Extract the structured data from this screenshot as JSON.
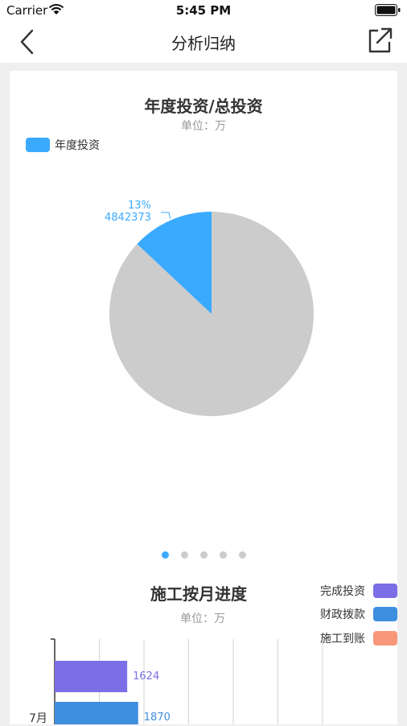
{
  "status": {
    "carrier": "Carrier",
    "time": "5:45 PM"
  },
  "nav": {
    "title": "分析归纳"
  },
  "pie_card": {
    "carousel_pages": 5,
    "active_page": 0
  },
  "bar_card": {
    "legend": [
      {
        "name": "完成投资",
        "color": "#7b6ee6"
      },
      {
        "name": "财政拨款",
        "color": "#3f8fe0"
      },
      {
        "name": "施工到账",
        "color": "#f8977a"
      }
    ]
  },
  "chart_data": [
    {
      "type": "pie",
      "title": "年度投资/总投资",
      "subtitle": "单位：万",
      "legend": [
        "年度投资"
      ],
      "slices": [
        {
          "label": "年度投资",
          "value": 4842373,
          "percent": "13%",
          "color": "#3aaaff"
        },
        {
          "label": "",
          "value": 32406034,
          "color": "#cccccc"
        }
      ]
    },
    {
      "type": "bar",
      "orientation": "horizontal",
      "title": "施工按月进度",
      "subtitle": "单位：万",
      "categories": [
        "7月"
      ],
      "series": [
        {
          "name": "完成投资",
          "values": [
            1624
          ],
          "color": "#7b6ee6"
        },
        {
          "name": "财政拨款",
          "values": [
            1870
          ],
          "color": "#3f8fe0"
        }
      ],
      "xlim": [
        0,
        6000
      ],
      "grid": true
    }
  ]
}
